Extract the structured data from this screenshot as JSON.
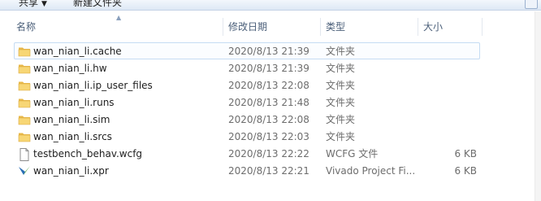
{
  "toolbar": {
    "share_label": "共享",
    "share_caret": "▼",
    "new_folder_label": "新建文件夹"
  },
  "columns": {
    "name": "名称",
    "date": "修改日期",
    "type": "类型",
    "size": "大小"
  },
  "files": [
    {
      "name": "wan_nian_li.cache",
      "date": "2020/8/13 21:39",
      "type": "文件夹",
      "size": "",
      "icon": "folder-icon",
      "selected": true
    },
    {
      "name": "wan_nian_li.hw",
      "date": "2020/8/13 21:39",
      "type": "文件夹",
      "size": "",
      "icon": "folder-icon"
    },
    {
      "name": "wan_nian_li.ip_user_files",
      "date": "2020/8/13 22:08",
      "type": "文件夹",
      "size": "",
      "icon": "folder-icon"
    },
    {
      "name": "wan_nian_li.runs",
      "date": "2020/8/13 21:48",
      "type": "文件夹",
      "size": "",
      "icon": "folder-icon"
    },
    {
      "name": "wan_nian_li.sim",
      "date": "2020/8/13 22:08",
      "type": "文件夹",
      "size": "",
      "icon": "folder-icon"
    },
    {
      "name": "wan_nian_li.srcs",
      "date": "2020/8/13 22:03",
      "type": "文件夹",
      "size": "",
      "icon": "folder-icon"
    },
    {
      "name": "testbench_behav.wcfg",
      "date": "2020/8/13 22:22",
      "type": "WCFG 文件",
      "size": "6 KB",
      "icon": "file-icon"
    },
    {
      "name": "wan_nian_li.xpr",
      "date": "2020/8/13 22:21",
      "type": "Vivado Project Fi...",
      "size": "6 KB",
      "icon": "vivado-project-icon"
    }
  ]
}
